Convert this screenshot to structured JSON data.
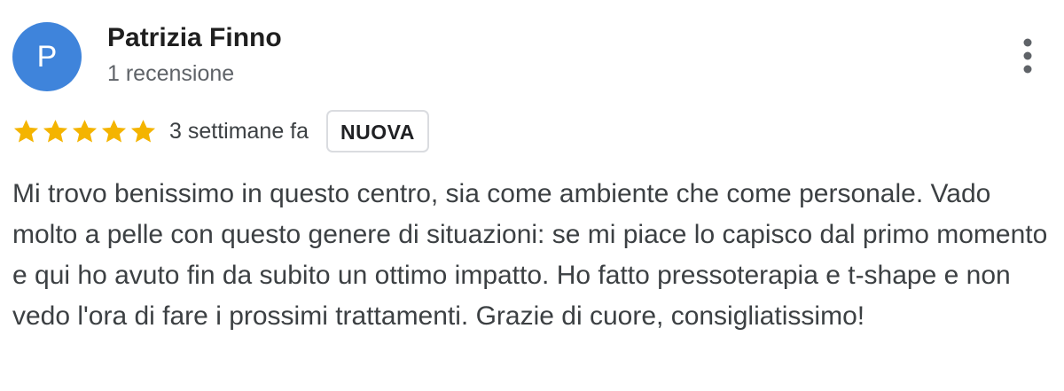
{
  "review": {
    "avatar_letter": "P",
    "avatar_color": "#3f84db",
    "author_name": "Patrizia Finno",
    "review_count": "1 recensione",
    "more_icon": "more-vert-icon",
    "rating": 5,
    "rating_max": 5,
    "star_icon": "star-icon",
    "star_color": "#f4b400",
    "date": "3 settimane fa",
    "badge": "NUOVA",
    "text": "Mi trovo benissimo in questo centro, sia come ambiente che come personale. Vado molto a pelle con questo genere di situazioni: se mi piace lo capisco dal primo momento e qui ho avuto fin da subito un ottimo impatto. Ho fatto pressoterapia e t-shape e non vedo l'ora di fare i prossimi trattamenti. Grazie di cuore, consigliatissimo!"
  }
}
